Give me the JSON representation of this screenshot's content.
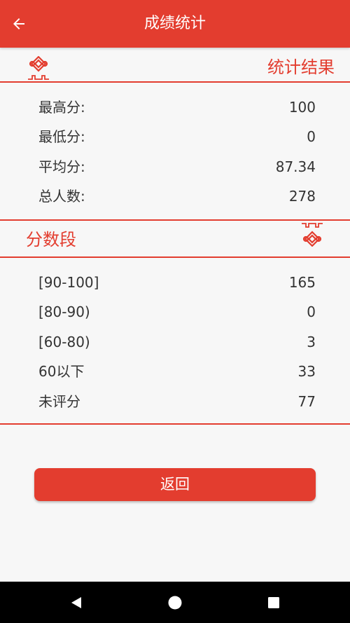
{
  "appbar": {
    "title": "成绩统计",
    "back_icon": "arrow-left-icon"
  },
  "stats_section": {
    "title": "统计结果",
    "rows": [
      {
        "label": "最高分:",
        "value": "100"
      },
      {
        "label": "最低分:",
        "value": "0"
      },
      {
        "label": "平均分:",
        "value": "87.34"
      },
      {
        "label": "总人数:",
        "value": "278"
      }
    ]
  },
  "range_section": {
    "title": "分数段",
    "rows": [
      {
        "label": "[90-100]",
        "value": "165"
      },
      {
        "label": "[80-90)",
        "value": "0"
      },
      {
        "label": "[60-80)",
        "value": "3"
      },
      {
        "label": "60以下",
        "value": "33"
      },
      {
        "label": "未评分",
        "value": "77"
      }
    ]
  },
  "return_button": {
    "label": "返回"
  },
  "colors": {
    "accent": "#e33d2f",
    "background": "#f7f7f7"
  },
  "navbar": {
    "icons": [
      "back-triangle-icon",
      "home-circle-icon",
      "recents-square-icon"
    ]
  }
}
